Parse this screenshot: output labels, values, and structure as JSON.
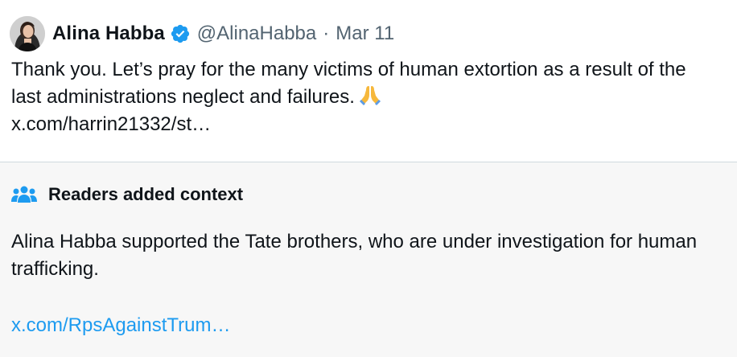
{
  "tweet": {
    "author_name": "Alina Habba",
    "author_handle": "@AlinaHabba",
    "separator": "·",
    "date": "Mar 11",
    "text": "Thank you. Let’s pray for the many victims of human extortion as a result of the last administrations neglect and failures.",
    "emoji": "folded-hands",
    "link": "x.com/harrin21332/st…"
  },
  "community_note": {
    "title": "Readers added context",
    "icon": "people-icon",
    "text": "Alina Habba supported the Tate brothers, who are under investigation for human trafficking.",
    "link": "x.com/RpsAgainstTrum…"
  },
  "colors": {
    "verified_blue": "#1d9bf0",
    "link_blue": "#1d9bf0",
    "secondary_text": "#536471",
    "context_bg": "#f7f7f7"
  }
}
